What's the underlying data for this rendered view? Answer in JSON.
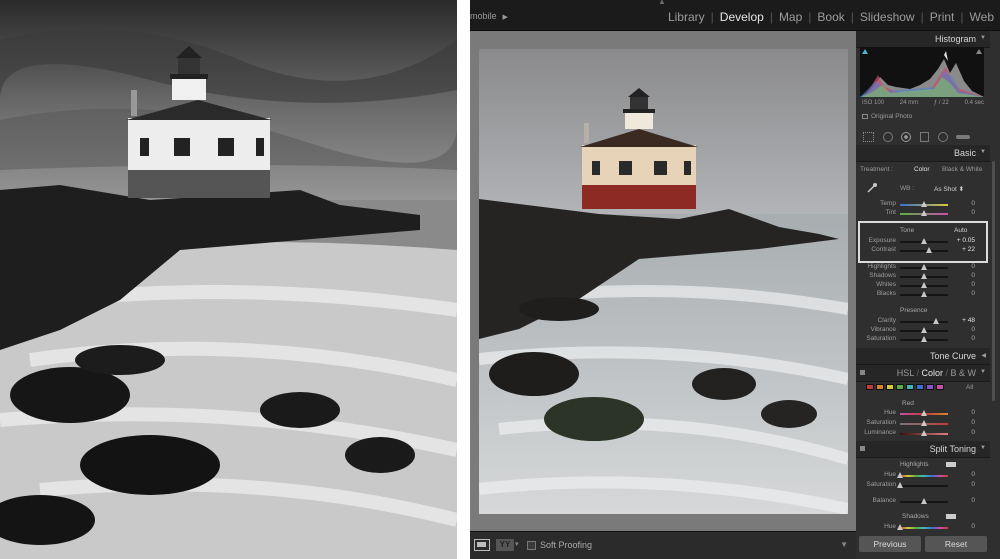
{
  "window": {
    "identity_plate": "mobile",
    "modules": [
      "Library",
      "Develop",
      "Map",
      "Book",
      "Slideshow",
      "Print",
      "Web"
    ],
    "active_module": "Develop"
  },
  "panels": {
    "histogram": {
      "title": "Histogram",
      "info": {
        "iso": "ISO 100",
        "focal": "24 mm",
        "aperture": "ƒ / 22",
        "shutter": "0.4 sec"
      },
      "original_photo_label": "Original Photo"
    },
    "basic": {
      "title": "Basic",
      "treatment_label": "Treatment :",
      "treatment_color": "Color",
      "treatment_bw": "Black & White",
      "wb_label": "WB :",
      "wb_value": "As Shot",
      "temp": {
        "label": "Temp",
        "value": "0"
      },
      "tint": {
        "label": "Tint",
        "value": "0"
      },
      "tone_label": "Tone",
      "tone_auto": "Auto",
      "exposure": {
        "label": "Exposure",
        "value": "+ 0.05"
      },
      "contrast": {
        "label": "Contrast",
        "value": "+ 22"
      },
      "highlights": {
        "label": "Highlights",
        "value": "0"
      },
      "shadows": {
        "label": "Shadows",
        "value": "0"
      },
      "whites": {
        "label": "Whites",
        "value": "0"
      },
      "blacks": {
        "label": "Blacks",
        "value": "0"
      },
      "presence_label": "Presence",
      "clarity": {
        "label": "Clarity",
        "value": "+ 48"
      },
      "vibrance": {
        "label": "Vibrance",
        "value": "0"
      },
      "saturation": {
        "label": "Saturation",
        "value": "0"
      }
    },
    "tone_curve": {
      "title": "Tone Curve"
    },
    "hsl": {
      "tab_hsl": "HSL",
      "tab_color": "Color",
      "tab_bw": "B & W",
      "all_label": "All",
      "swatches": [
        "#c23b3b",
        "#d9832b",
        "#d6c93a",
        "#58b043",
        "#3fb6b3",
        "#3a6fd1",
        "#8a4fc9",
        "#c94fa6"
      ],
      "group": "Red",
      "hue": {
        "label": "Hue",
        "value": "0"
      },
      "saturation": {
        "label": "Saturation",
        "value": "0"
      },
      "luminance": {
        "label": "Luminance",
        "value": "0"
      }
    },
    "split_toning": {
      "title": "Split Toning",
      "highlights_label": "Highlights",
      "hue": {
        "label": "Hue",
        "value": "0"
      },
      "saturation": {
        "label": "Saturation",
        "value": "0"
      },
      "balance": {
        "label": "Balance",
        "value": "0"
      },
      "shadows_label": "Shadows",
      "shadow_hue": {
        "label": "Hue",
        "value": "0"
      }
    }
  },
  "buttons": {
    "previous": "Previous",
    "reset": "Reset"
  },
  "toolbar": {
    "soft_proofing": "Soft Proofing"
  }
}
